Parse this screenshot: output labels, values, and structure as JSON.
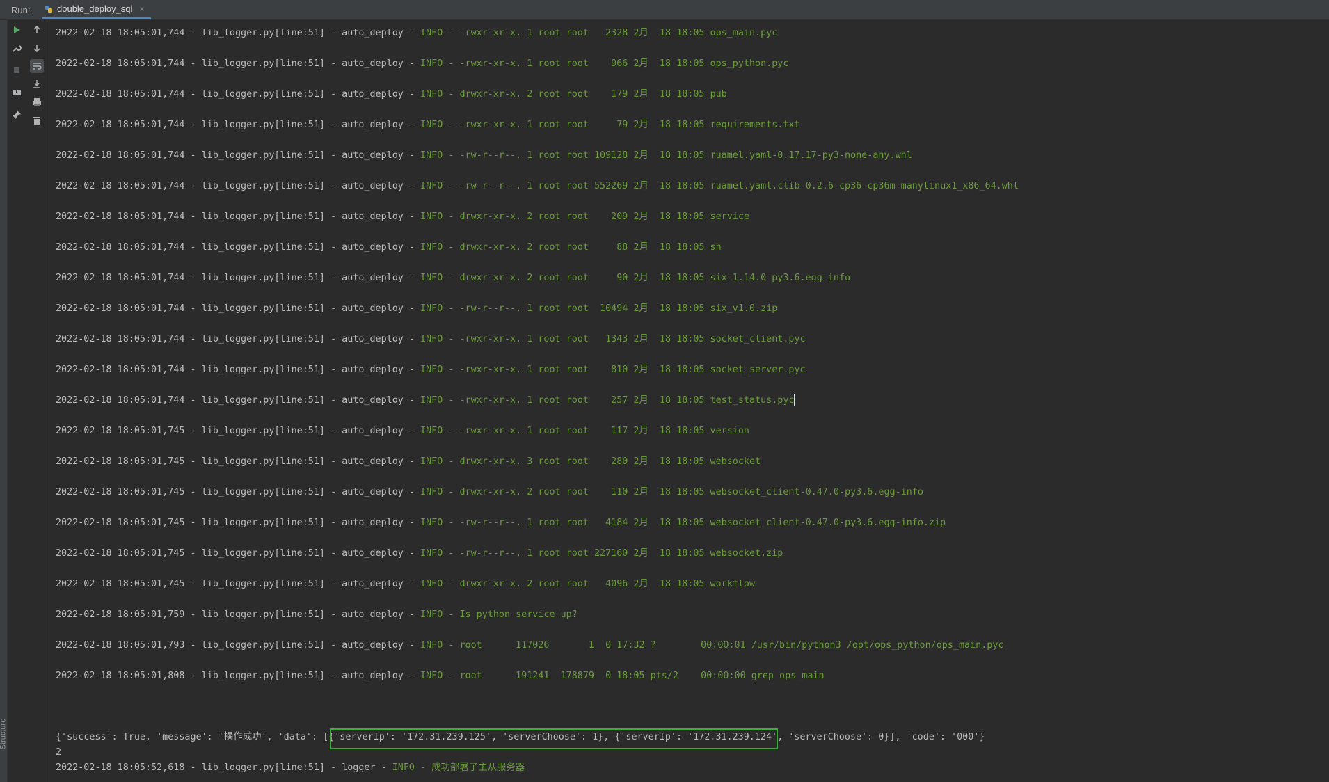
{
  "window": {
    "run_label": "Run:",
    "tab_title": "double_deploy_sql",
    "tab_close": "×",
    "structure_label": "Structure"
  },
  "log_prefix": {
    "ts1": "2022-02-18 18:05:01,744",
    "ts2": "2022-02-18 18:05:01,745",
    "source": " - lib_logger.py[line:51] - auto_deploy - "
  },
  "file_lines": [
    {
      "ts": "2022-02-18 18:05:01,744",
      "msg": "INFO - -rwxr-xr-x. 1 root root   2328 2月  18 18:05 ops_main.pyc"
    },
    {
      "ts": "2022-02-18 18:05:01,744",
      "msg": "INFO - -rwxr-xr-x. 1 root root    966 2月  18 18:05 ops_python.pyc"
    },
    {
      "ts": "2022-02-18 18:05:01,744",
      "msg": "INFO - drwxr-xr-x. 2 root root    179 2月  18 18:05 pub"
    },
    {
      "ts": "2022-02-18 18:05:01,744",
      "msg": "INFO - -rwxr-xr-x. 1 root root     79 2月  18 18:05 requirements.txt"
    },
    {
      "ts": "2022-02-18 18:05:01,744",
      "msg": "INFO - -rw-r--r--. 1 root root 109128 2月  18 18:05 ruamel.yaml-0.17.17-py3-none-any.whl"
    },
    {
      "ts": "2022-02-18 18:05:01,744",
      "msg": "INFO - -rw-r--r--. 1 root root 552269 2月  18 18:05 ruamel.yaml.clib-0.2.6-cp36-cp36m-manylinux1_x86_64.whl"
    },
    {
      "ts": "2022-02-18 18:05:01,744",
      "msg": "INFO - drwxr-xr-x. 2 root root    209 2月  18 18:05 service"
    },
    {
      "ts": "2022-02-18 18:05:01,744",
      "msg": "INFO - drwxr-xr-x. 2 root root     88 2月  18 18:05 sh"
    },
    {
      "ts": "2022-02-18 18:05:01,744",
      "msg": "INFO - drwxr-xr-x. 2 root root     90 2月  18 18:05 six-1.14.0-py3.6.egg-info"
    },
    {
      "ts": "2022-02-18 18:05:01,744",
      "msg": "INFO - -rw-r--r--. 1 root root  10494 2月  18 18:05 six_v1.0.zip"
    },
    {
      "ts": "2022-02-18 18:05:01,744",
      "msg": "INFO - -rwxr-xr-x. 1 root root   1343 2月  18 18:05 socket_client.pyc"
    },
    {
      "ts": "2022-02-18 18:05:01,744",
      "msg": "INFO - -rwxr-xr-x. 1 root root    810 2月  18 18:05 socket_server.pyc"
    },
    {
      "ts": "2022-02-18 18:05:01,744",
      "msg": "INFO - -rwxr-xr-x. 1 root root    257 2月  18 18:05 test_status.pyc"
    },
    {
      "ts": "2022-02-18 18:05:01,745",
      "msg": "INFO - -rwxr-xr-x. 1 root root    117 2月  18 18:05 version"
    },
    {
      "ts": "2022-02-18 18:05:01,745",
      "msg": "INFO - drwxr-xr-x. 3 root root    280 2月  18 18:05 websocket"
    },
    {
      "ts": "2022-02-18 18:05:01,745",
      "msg": "INFO - drwxr-xr-x. 2 root root    110 2月  18 18:05 websocket_client-0.47.0-py3.6.egg-info"
    },
    {
      "ts": "2022-02-18 18:05:01,745",
      "msg": "INFO - -rw-r--r--. 1 root root   4184 2月  18 18:05 websocket_client-0.47.0-py3.6.egg-info.zip"
    },
    {
      "ts": "2022-02-18 18:05:01,745",
      "msg": "INFO - -rw-r--r--. 1 root root 227160 2月  18 18:05 websocket.zip"
    },
    {
      "ts": "2022-02-18 18:05:01,745",
      "msg": "INFO - drwxr-xr-x. 2 root root   4096 2月  18 18:05 workflow"
    },
    {
      "ts": "2022-02-18 18:05:01,759",
      "msg": "INFO - Is python service up?"
    },
    {
      "ts": "2022-02-18 18:05:01,793",
      "msg": "INFO - root      117026       1  0 17:32 ?        00:00:01 /usr/bin/python3 /opt/ops_python/ops_main.pyc"
    },
    {
      "ts": "2022-02-18 18:05:01,808",
      "msg": "INFO - root      191241  178879  0 18:05 pts/2    00:00:00 grep ops_main"
    }
  ],
  "result_line": "{'success': True, 'message': '操作成功', 'data': [{'serverIp': '172.31.239.125', 'serverChoose': 1}, {'serverIp': '172.31.239.124', 'serverChoose': 0}], 'code': '000'}",
  "count_line": "2",
  "final_log": {
    "ts": "2022-02-18 18:05:52,618",
    "source": " - lib_logger.py[line:51] - logger - ",
    "msg": "INFO - 成功部署了主从服务器"
  }
}
